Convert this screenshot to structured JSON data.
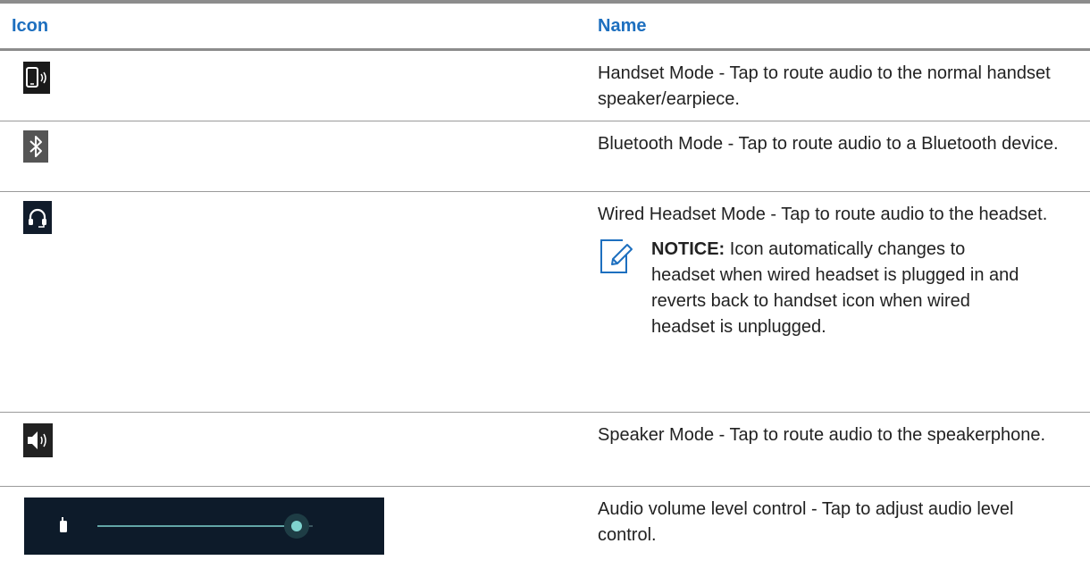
{
  "table": {
    "headers": {
      "icon": "Icon",
      "name": "Name"
    },
    "rows": [
      {
        "icon": "handset-mode-icon",
        "description": "Handset Mode - Tap to route audio to the normal handset speaker/earpiece."
      },
      {
        "icon": "bluetooth-icon",
        "description": "Bluetooth Mode - Tap to route audio to a Bluetooth device."
      },
      {
        "icon": "headset-icon",
        "description": "Wired Headset Mode - Tap to route audio to the headset.",
        "notice": {
          "label": "NOTICE:",
          "text": "Icon automatically changes to headset when wired headset is plugged in and reverts back to handset icon when wired headset is unplugged."
        }
      },
      {
        "icon": "speaker-icon",
        "description": "Speaker Mode - Tap to route audio to the speakerphone."
      },
      {
        "icon": "volume-slider-icon",
        "description": "Audio volume level control - Tap to adjust audio level control."
      }
    ]
  },
  "colors": {
    "header_text": "#1d6fbf",
    "rule": "#8c8c8c",
    "notice_icon": "#1d6fbf",
    "slider_accent": "#7fd3cf"
  }
}
